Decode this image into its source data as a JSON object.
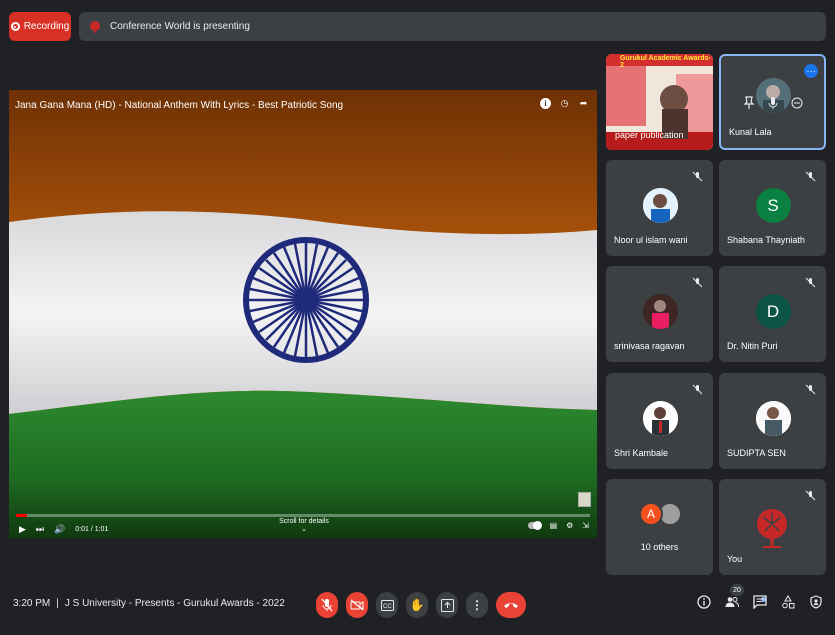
{
  "top": {
    "recording_label": "Recording",
    "presenting_text": "Conference World is presenting"
  },
  "video": {
    "title": "Jana Gana Mana (HD) - National Anthem With Lyrics - Best Patriotic Song",
    "time": "0:01 / 1:01",
    "scroll_hint": "Scroll for details",
    "progress_percent": 2
  },
  "presentation_tile": {
    "name": "paper publication",
    "banner_text": "Gurukul Academic Awards-2"
  },
  "participants": [
    {
      "name": "Kunal Lala",
      "initial": "",
      "avatar_color": "#5f6368",
      "muted": false
    },
    {
      "name": "Noor ul islam wani",
      "initial": "",
      "avatar_color": "#ffffff",
      "muted": true
    },
    {
      "name": "Shabana Thayniath",
      "initial": "S",
      "avatar_color": "#0b8043",
      "muted": true
    },
    {
      "name": "srinivasa ragavan",
      "initial": "",
      "avatar_color": "#2f2f2f",
      "muted": true
    },
    {
      "name": "Dr. Nitin Puri",
      "initial": "D",
      "avatar_color": "#0b5345",
      "muted": true
    },
    {
      "name": "Shri Kambale",
      "initial": "",
      "avatar_color": "#ffffff",
      "muted": true
    },
    {
      "name": "SUDIPTA SEN",
      "initial": "",
      "avatar_color": "#ffffff",
      "muted": true
    },
    {
      "name": "10 others",
      "initial": "A",
      "avatar_color": "#f4511e",
      "muted": false
    },
    {
      "name": "You",
      "initial": "",
      "avatar_color": "#3c4043",
      "muted": true
    }
  ],
  "bottom": {
    "time": "3:20 PM",
    "meeting_title": "J S University - Presents - Gurukul Awards - 2022",
    "participant_count": "20"
  },
  "colors": {
    "end_call": "#ea4335",
    "accent": "#8ab4f8"
  }
}
